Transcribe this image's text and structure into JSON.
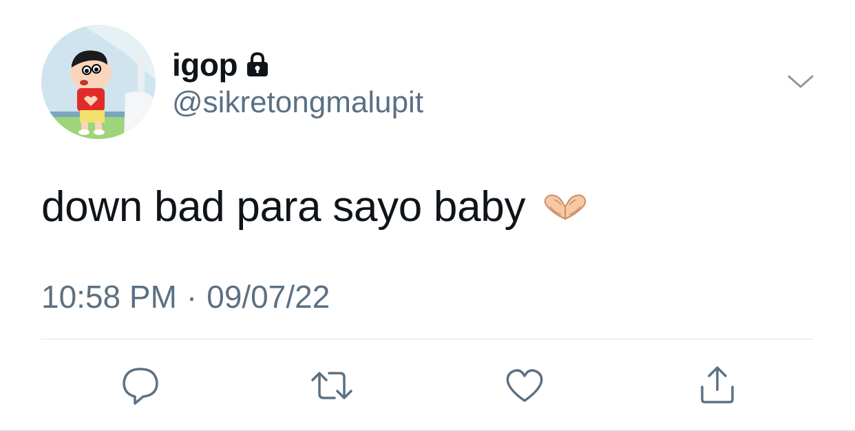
{
  "user": {
    "display_name": "igop",
    "handle": "@sikretongmalupit",
    "verified_icon": "lock-icon",
    "avatar": "avatar-cartoon-boy-heart-hands"
  },
  "tweet": {
    "text": "down bad para sayo baby",
    "emoji_icon": "heart-hands-icon",
    "time": "10:58 PM",
    "separator": "·",
    "date": "09/07/22"
  },
  "menu": {
    "icon": "chevron-down-icon"
  },
  "actions": [
    {
      "name": "reply",
      "icon": "reply-icon"
    },
    {
      "name": "retweet",
      "icon": "retweet-icon"
    },
    {
      "name": "like",
      "icon": "heart-icon"
    },
    {
      "name": "share",
      "icon": "share-icon"
    }
  ],
  "colors": {
    "text_primary": "#0f1419",
    "text_secondary": "#5b7083",
    "divider": "#dfe3e6"
  }
}
